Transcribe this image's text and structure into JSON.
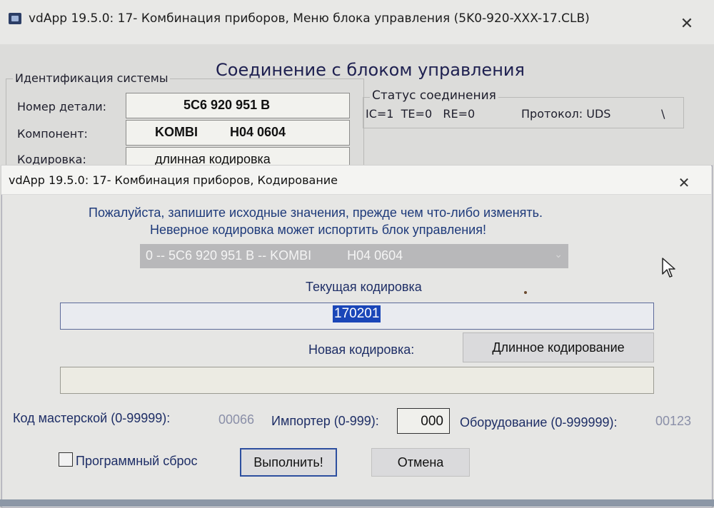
{
  "back_window": {
    "title": "vdApp 19.5.0: 17- Комбинация приборов,  Меню блока управления (5K0-920-XXX-17.CLB)",
    "close_glyph": "✕",
    "heading": "Соединение с блоком управления",
    "identification": {
      "legend": "Идентификация системы",
      "part_number_label": "Номер детали:",
      "part_number_value": "5C6 920 951 B",
      "component_label": "Компонент:",
      "component_value": "KOMBI         H04 0604",
      "coding_label": "Кодировка:",
      "coding_value": "длинная кодировка"
    },
    "connection_status": {
      "legend": "Статус соединения",
      "counters": "IC=1  TE=0   RE=0",
      "protocol": "Протокол: UDS",
      "spinner": "\\"
    }
  },
  "dialog": {
    "title": "vdApp 19.5.0: 17- Комбинация приборов,  Кодирование",
    "close_glyph": "✕",
    "warning_line1": "Пожалуйста, запишите исходные значения, прежде чем что-либо изменять.",
    "warning_line2": "Неверное кодировка может испортить блок управления!",
    "module_select": {
      "selected": "0 -- 5C6 920 951 B -- KOMBI          H04 0604",
      "chevron": "⌄"
    },
    "current_coding_label": "Текущая кодировка",
    "current_coding_value": "170201",
    "new_coding_label": "Новая кодировка:",
    "long_coding_button": "Длинное кодирование",
    "new_coding_value": "",
    "workshop_code_label": "Код мастерской (0-99999):",
    "workshop_code_value": "00066",
    "importer_label": "Импортер (0-999):",
    "importer_value": "000",
    "equipment_label": "Оборудование (0-999999):",
    "equipment_value": "00123",
    "software_reset_label": "Программный сброс",
    "software_reset_checked": false,
    "execute_button": "Выполнить!",
    "cancel_button": "Отмена"
  },
  "icons": {
    "app": "app-icon",
    "cursor": "mouse-pointer-icon"
  }
}
